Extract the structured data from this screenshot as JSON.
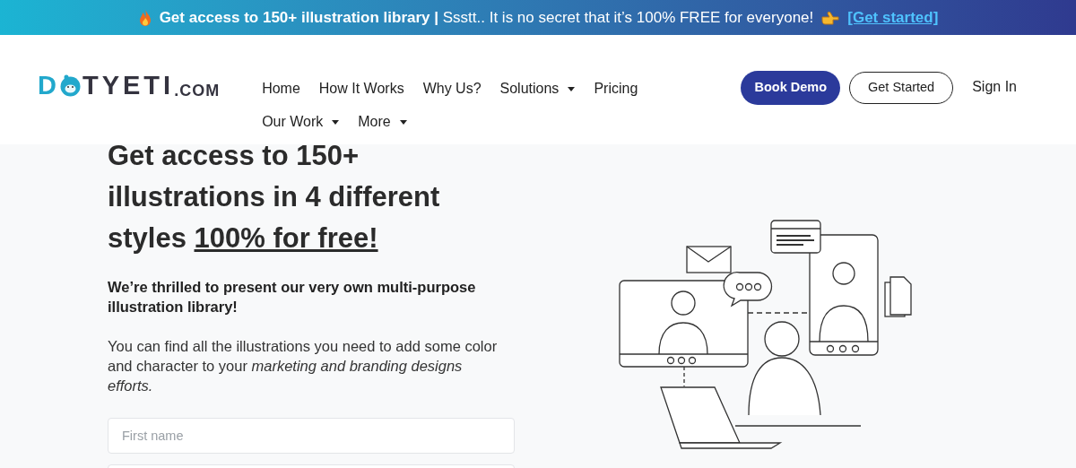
{
  "banner": {
    "text": "**Get access to 150+ illustration library |** Ssstt.. It is no secret that it’s 100% FREE for everyone!",
    "link": "[Get started]"
  },
  "logo": {
    "first": "D",
    "middle": "TYETI",
    "suffix": ".COM"
  },
  "nav": [
    {
      "label": "Home",
      "dropdown": false
    },
    {
      "label": "How It Works",
      "dropdown": false
    },
    {
      "label": "Why Us?",
      "dropdown": false
    },
    {
      "label": "Solutions",
      "dropdown": true
    },
    {
      "label": "Pricing",
      "dropdown": false
    },
    {
      "label": "Our Work",
      "dropdown": true
    },
    {
      "label": "More",
      "dropdown": true
    }
  ],
  "actions": [
    {
      "kind": "primary",
      "label": "Book Demo"
    },
    {
      "kind": "outline",
      "label": "Get Started"
    },
    {
      "kind": "link",
      "label": "Sign In"
    }
  ],
  "hero": {
    "heading": "Get access to 150+ illustrations in 4 different styles",
    "heading_underlined": "100% for free!",
    "subheading": "We’re thrilled to present our very own multi-purpose illustration library!",
    "paragraph": "You can find all the illustrations you need to add some color and character to your *marketing and branding designs efforts.*"
  },
  "form": {
    "fields": [
      {
        "kind": "text",
        "placeholder": "First name"
      },
      {
        "kind": "text"
      }
    ]
  }
}
